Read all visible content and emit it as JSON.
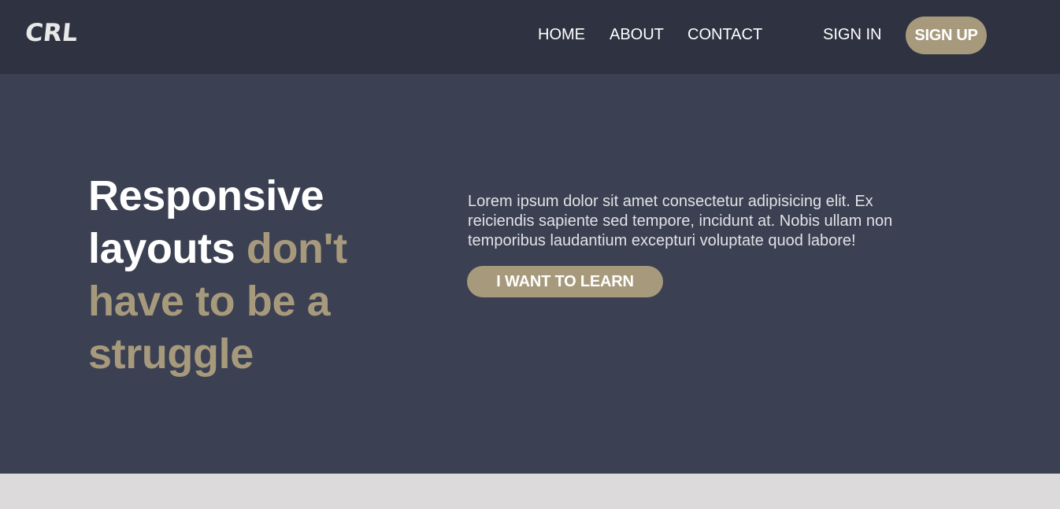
{
  "header": {
    "logo": "CRL",
    "nav": {
      "home": "HOME",
      "about": "ABOUT",
      "contact": "CONTACT",
      "sign_in": "SIGN IN",
      "sign_up": "SIGN UP"
    }
  },
  "hero": {
    "headline_white": "Responsive layouts",
    "headline_accent": "don't have to be a struggle",
    "body": "Lorem ipsum dolor sit amet consectetur adipisicing elit. Ex reiciendis sapiente sed tempore, incidunt at. Nobis ullam non temporibus laudantium excepturi voluptate quod labore!",
    "cta": "I WANT TO LEARN"
  },
  "colors": {
    "header_bg": "#2f3341",
    "hero_bg": "#3b4052",
    "accent": "#a79a7c",
    "page_bg": "#dcdadb"
  }
}
